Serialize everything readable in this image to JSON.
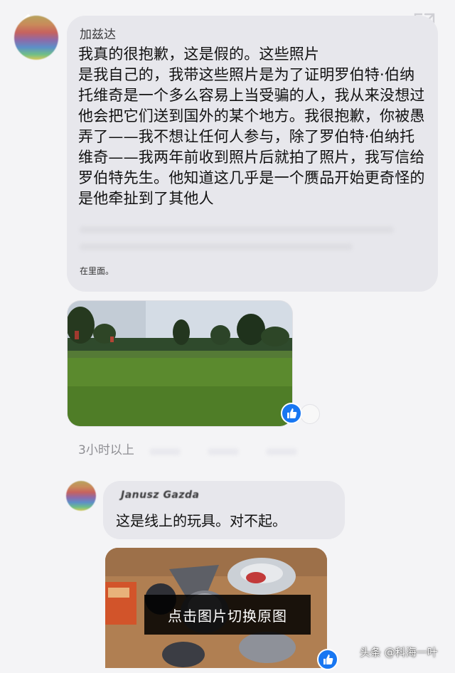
{
  "header": {
    "back_icon": "chevron-left-icon",
    "expand_icon": "external-expand-icon"
  },
  "message_1": {
    "author": "加兹达",
    "text": "我真的很抱歉，这是假的。这些照片\n是我自己的，我带这些照片是为了证明罗伯特·伯纳托维奇是一个多么容易上当受骗的人，我从来没想过他会把它们送到国外的某个地方。我很抱歉，你被愚弄了——我不想让任何人参与，除了罗伯特·伯纳托维奇——我两年前收到照片后就拍了照片，我写信给罗伯特先生。他知道这几乎是一个赝品开始更奇怪的是他牵扯到了其他人",
    "note": "在里面。",
    "photo_icon": "landscape-photo",
    "reaction_icon": "thumbs-up-icon",
    "timestamp": "3小时以上"
  },
  "message_2": {
    "author": "Janusz Gazda",
    "text": "这是线上的玩具。对不起。",
    "photo_icon": "objects-photo",
    "reaction_icon": "thumbs-up-icon"
  },
  "overlay": {
    "toast": "点击图片切换原图",
    "watermark": "头条 @科海一叶"
  },
  "colors": {
    "bubble": "#e7e7ec",
    "background": "#f4f4f6",
    "like_blue": "#1877f2",
    "toast_bg": "#000000"
  }
}
